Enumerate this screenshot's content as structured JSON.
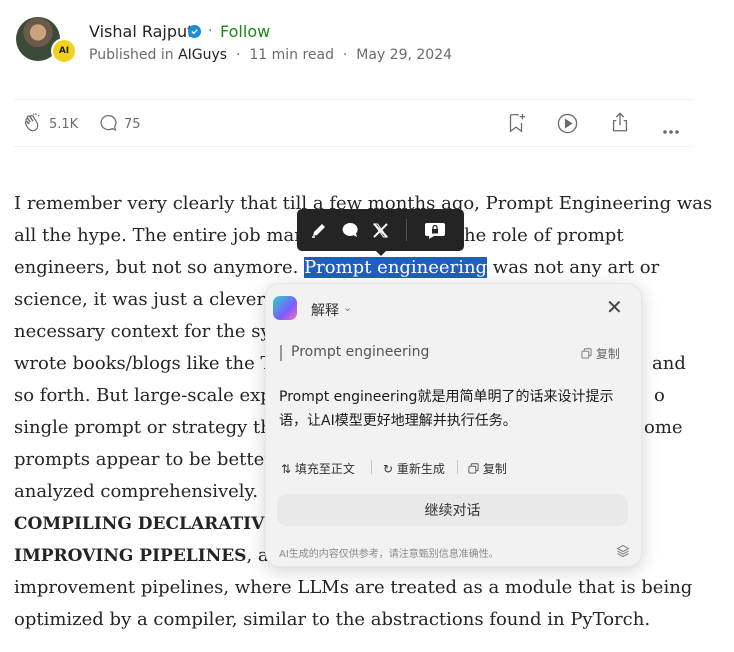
{
  "author": {
    "name": "Vishal Rajput",
    "follow_label": "Follow",
    "published_in_label": "Published in",
    "publication": "AIGuys",
    "read_time": "11 min read",
    "date": "May 29, 2024",
    "badge_text": "AI"
  },
  "actions": {
    "claps": "5.1K",
    "responses": "75"
  },
  "article": {
    "lines": [
      "I remember very clearly that till a few months ago, Prompt Engineering was",
      "all the hype. The entire job mark",
      "he role of prompt",
      "engineers, but not so anymore. ",
      "Prompt engineering",
      " was not any art or",
      "science, it was just a clever H",
      "necessary context for the sys",
      "wrote books/blogs like the To",
      "and",
      "so forth. But large-scale expe",
      "o",
      "single prompt or strategy tha",
      "ome",
      "prompts appear to be better",
      "analyzed comprehensively. S",
      "COMPILING DECLARATIVE",
      "IMPROVING PIPELINES",
      ", a fr",
      "improvement pipelines, where LLMs are treated as a module that is being",
      "optimized by a compiler, similar to the abstractions found in PyTorch."
    ]
  },
  "popup": {
    "title": "解释",
    "quote": "Prompt engineering",
    "copy_label": "复制",
    "answer": "Prompt engineering就是用简单明了的话来设计提示语，让AI模型更好地理解并执行任务。",
    "fill_label": "填充至正文",
    "regenerate_label": "重新生成",
    "copy2_label": "复制",
    "continue_label": "继续对话",
    "disclaimer": "AI生成的内容仅供参考，请注意甄别信息准确性。"
  }
}
